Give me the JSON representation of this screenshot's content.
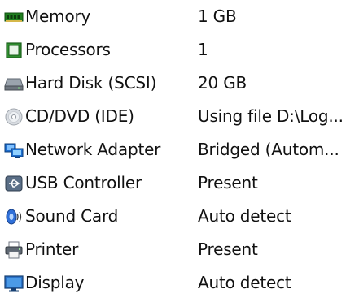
{
  "devices": [
    {
      "name": "Memory",
      "value": "1 GB",
      "icon": "memory-icon"
    },
    {
      "name": "Processors",
      "value": "1",
      "icon": "processor-icon"
    },
    {
      "name": "Hard Disk (SCSI)",
      "value": "20 GB",
      "icon": "hard-disk-icon"
    },
    {
      "name": "CD/DVD (IDE)",
      "value": "Using file D:\\Log...",
      "icon": "cd-dvd-icon"
    },
    {
      "name": "Network Adapter",
      "value": "Bridged (Autom...",
      "icon": "network-adapter-icon"
    },
    {
      "name": "USB Controller",
      "value": "Present",
      "icon": "usb-controller-icon"
    },
    {
      "name": "Sound Card",
      "value": "Auto detect",
      "icon": "sound-card-icon"
    },
    {
      "name": "Printer",
      "value": "Present",
      "icon": "printer-icon"
    },
    {
      "name": "Display",
      "value": "Auto detect",
      "icon": "display-icon"
    }
  ]
}
